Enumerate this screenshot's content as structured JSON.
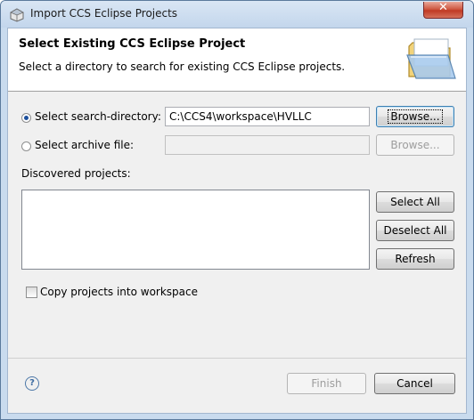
{
  "window": {
    "title": "Import CCS Eclipse Projects",
    "close_label": "✕"
  },
  "header": {
    "title": "Select Existing CCS Eclipse Project",
    "description": "Select a directory to search for existing CCS Eclipse projects."
  },
  "search_directory": {
    "label": "Select search-directory:",
    "value": "C:\\CCS4\\workspace\\HVLLC",
    "browse_label": "Browse...",
    "selected": true
  },
  "archive_file": {
    "label": "Select archive file:",
    "value": "",
    "browse_label": "Browse...",
    "selected": false
  },
  "projects": {
    "label": "Discovered projects:",
    "items": [],
    "select_all_label": "Select All",
    "deselect_all_label": "Deselect All",
    "refresh_label": "Refresh"
  },
  "options": {
    "copy_label": "Copy projects into workspace",
    "copy_checked": false
  },
  "footer": {
    "help_symbol": "?",
    "finish_label": "Finish",
    "cancel_label": "Cancel"
  },
  "colors": {
    "title_bar": "#c9dbee",
    "close_button": "#c03a24",
    "panel": "#f0f0f0",
    "radio_dot": "#1c4f9c"
  },
  "icons": [
    "app-icon",
    "close-icon",
    "folder-icon",
    "help-icon"
  ]
}
